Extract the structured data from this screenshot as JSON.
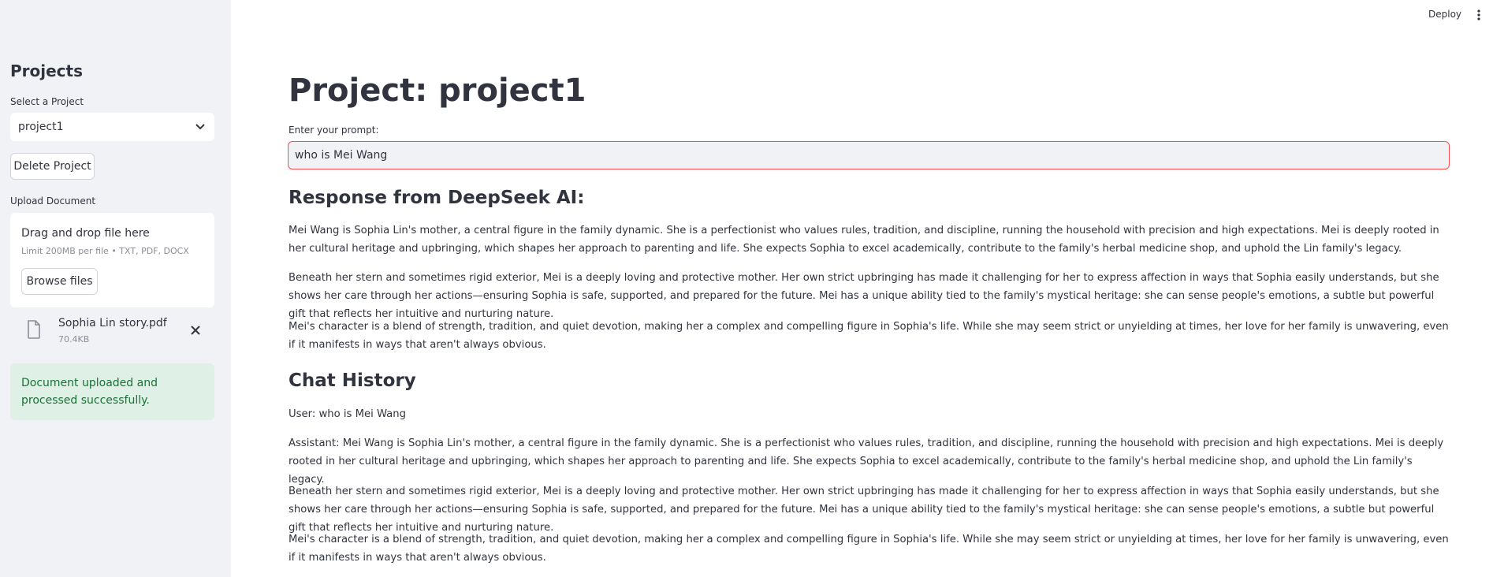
{
  "header": {
    "deploy_label": "Deploy",
    "menu_icon": "kebab-menu-icon"
  },
  "sidebar": {
    "title": "Projects",
    "select_label": "Select a Project",
    "selected_project": "project1",
    "delete_button": "Delete Project",
    "upload_label": "Upload Document",
    "dropzone_title": "Drag and drop file here",
    "dropzone_limit": "Limit 200MB per file • TXT, PDF, DOCX",
    "browse_button": "Browse files",
    "uploaded_file": {
      "name": "Sophia Lin story.pdf",
      "size": "70.4KB"
    },
    "success_message": "Document uploaded and processed successfully."
  },
  "main": {
    "title": "Project: project1",
    "prompt_label": "Enter your prompt:",
    "prompt_value": "who is Mei Wang",
    "response_heading": "Response from DeepSeek AI:",
    "response_paragraphs": [
      "Mei Wang is Sophia Lin's mother, a central figure in the family dynamic. She is a perfectionist who values rules, tradition, and discipline, running the household with precision and high expectations. Mei is deeply rooted in her cultural heritage and upbringing, which shapes her approach to parenting and life. She expects Sophia to excel academically, contribute to the family's herbal medicine shop, and uphold the Lin family's legacy.",
      "Beneath her stern and sometimes rigid exterior, Mei is a deeply loving and protective mother. Her own strict upbringing has made it challenging for her to express affection in ways that Sophia easily understands, but she shows her care through her actions—ensuring Sophia is safe, supported, and prepared for the future. Mei has a unique ability tied to the family's mystical heritage: she can sense people's emotions, a subtle but powerful gift that reflects her intuitive and nurturing nature.",
      "Mei's character is a blend of strength, tradition, and quiet devotion, making her a complex and compelling figure in Sophia's life. While she may seem strict or unyielding at times, her love for her family is unwavering, even if it manifests in ways that aren't always obvious."
    ],
    "history_heading": "Chat History",
    "history": [
      "User: who is Mei Wang",
      "Assistant: Mei Wang is Sophia Lin's mother, a central figure in the family dynamic. She is a perfectionist who values rules, tradition, and discipline, running the household with precision and high expectations. Mei is deeply rooted in her cultural heritage and upbringing, which shapes her approach to parenting and life. She expects Sophia to excel academically, contribute to the family's herbal medicine shop, and uphold the Lin family's legacy.",
      "Beneath her stern and sometimes rigid exterior, Mei is a deeply loving and protective mother. Her own strict upbringing has made it challenging for her to express affection in ways that Sophia easily understands, but she shows her care through her actions—ensuring Sophia is safe, supported, and prepared for the future. Mei has a unique ability tied to the family's mystical heritage: she can sense people's emotions, a subtle but powerful gift that reflects her intuitive and nurturing nature.",
      "Mei's character is a blend of strength, tradition, and quiet devotion, making her a complex and compelling figure in Sophia's life. While she may seem strict or unyielding at times, her love for her family is unwavering, even if it manifests in ways that aren't always obvious."
    ]
  },
  "colors": {
    "sidebar_bg": "#f0f2f6",
    "accent_red": "#ff4b4b",
    "success_bg": "#dff0e7",
    "success_text": "#177233"
  }
}
